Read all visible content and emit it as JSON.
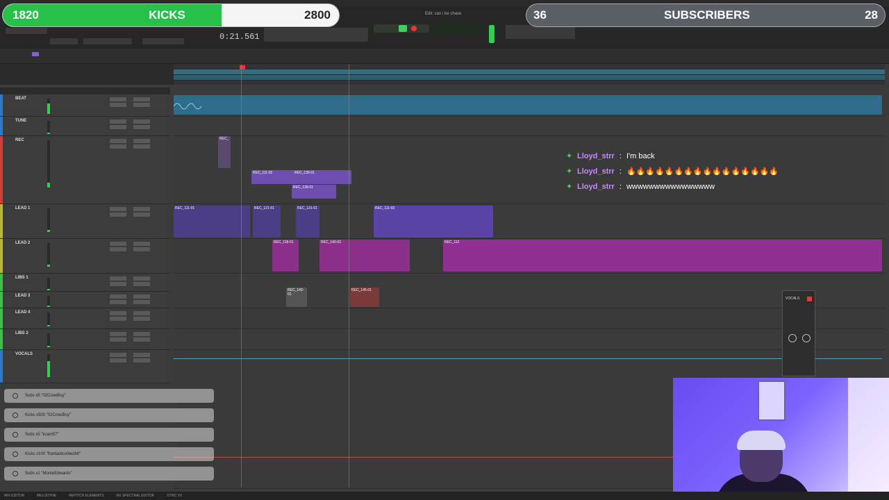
{
  "goals": {
    "kicks": {
      "current": "1820",
      "label": "KICKS",
      "target": "2800",
      "progress_percent": 65
    },
    "subscribers": {
      "current": "36",
      "label": "SUBSCRIBERS",
      "target": "28"
    }
  },
  "transport": {
    "counter": "0:21.561"
  },
  "window": {
    "title": "Edit: can i be chase"
  },
  "tracks": [
    {
      "name": "BEAT",
      "color": "#2a7ac8"
    },
    {
      "name": "TUNE",
      "color": "#2a7ac8"
    },
    {
      "name": "REC",
      "color": "#d33a3a"
    },
    {
      "name": "LEAD 1",
      "color": "#b8b832"
    },
    {
      "name": "LEAD 2",
      "color": "#b8b832"
    },
    {
      "name": "LIBS 1",
      "color": "#3fbf4a"
    },
    {
      "name": "LEAD 3",
      "color": "#3fbf4a"
    },
    {
      "name": "LEAD 4",
      "color": "#3fbf4a"
    },
    {
      "name": "LIBS 2",
      "color": "#3fbf4a"
    },
    {
      "name": "VOCALS",
      "color": "#2a7ac8"
    }
  ],
  "clips": {
    "rec_a": "REC_",
    "rec_b": "REC_111-02",
    "rec_c": "REC_139-01",
    "rec_d": "REC_139-01",
    "lead1_a": "REC_111-01",
    "lead1_b": "REC_121-01",
    "lead1_c": "REC_131-01",
    "lead1_d": "REC_111-03",
    "lead2_a": "REC_118-01",
    "lead2_b": "REC_140-03",
    "lead2_c": "REC_112",
    "libs_a": "REC_143-01",
    "libs_b": "REC_145-01"
  },
  "chat": [
    {
      "user": "Lloyd_strr",
      "message": "I'm back"
    },
    {
      "user": "Lloyd_strr",
      "message": "🔥🔥🔥🔥🔥🔥🔥🔥🔥🔥🔥🔥🔥🔥🔥🔥"
    },
    {
      "user": "Lloyd_strr",
      "message": "wwwwwwwwwwwwwwww"
    }
  ],
  "alerts": [
    {
      "text": "Subs x5 \"02CrowBoy\""
    },
    {
      "text": "Kicks x500 \"02CrowBoy\""
    },
    {
      "text": "Subs x5 \"kcam57\""
    },
    {
      "text": "Kicks x100 \"frantasticvibez86\""
    },
    {
      "text": "Subs x1 \"MonteEdwards\""
    }
  ],
  "plugin": {
    "title": "VOCALS"
  },
  "bottom_tabs": [
    "MIX EDITOR",
    "MELODYNE",
    "REPITCH ELEMENTS",
    "RX SPECTRAL EDITOR",
    "SYNC VX"
  ]
}
